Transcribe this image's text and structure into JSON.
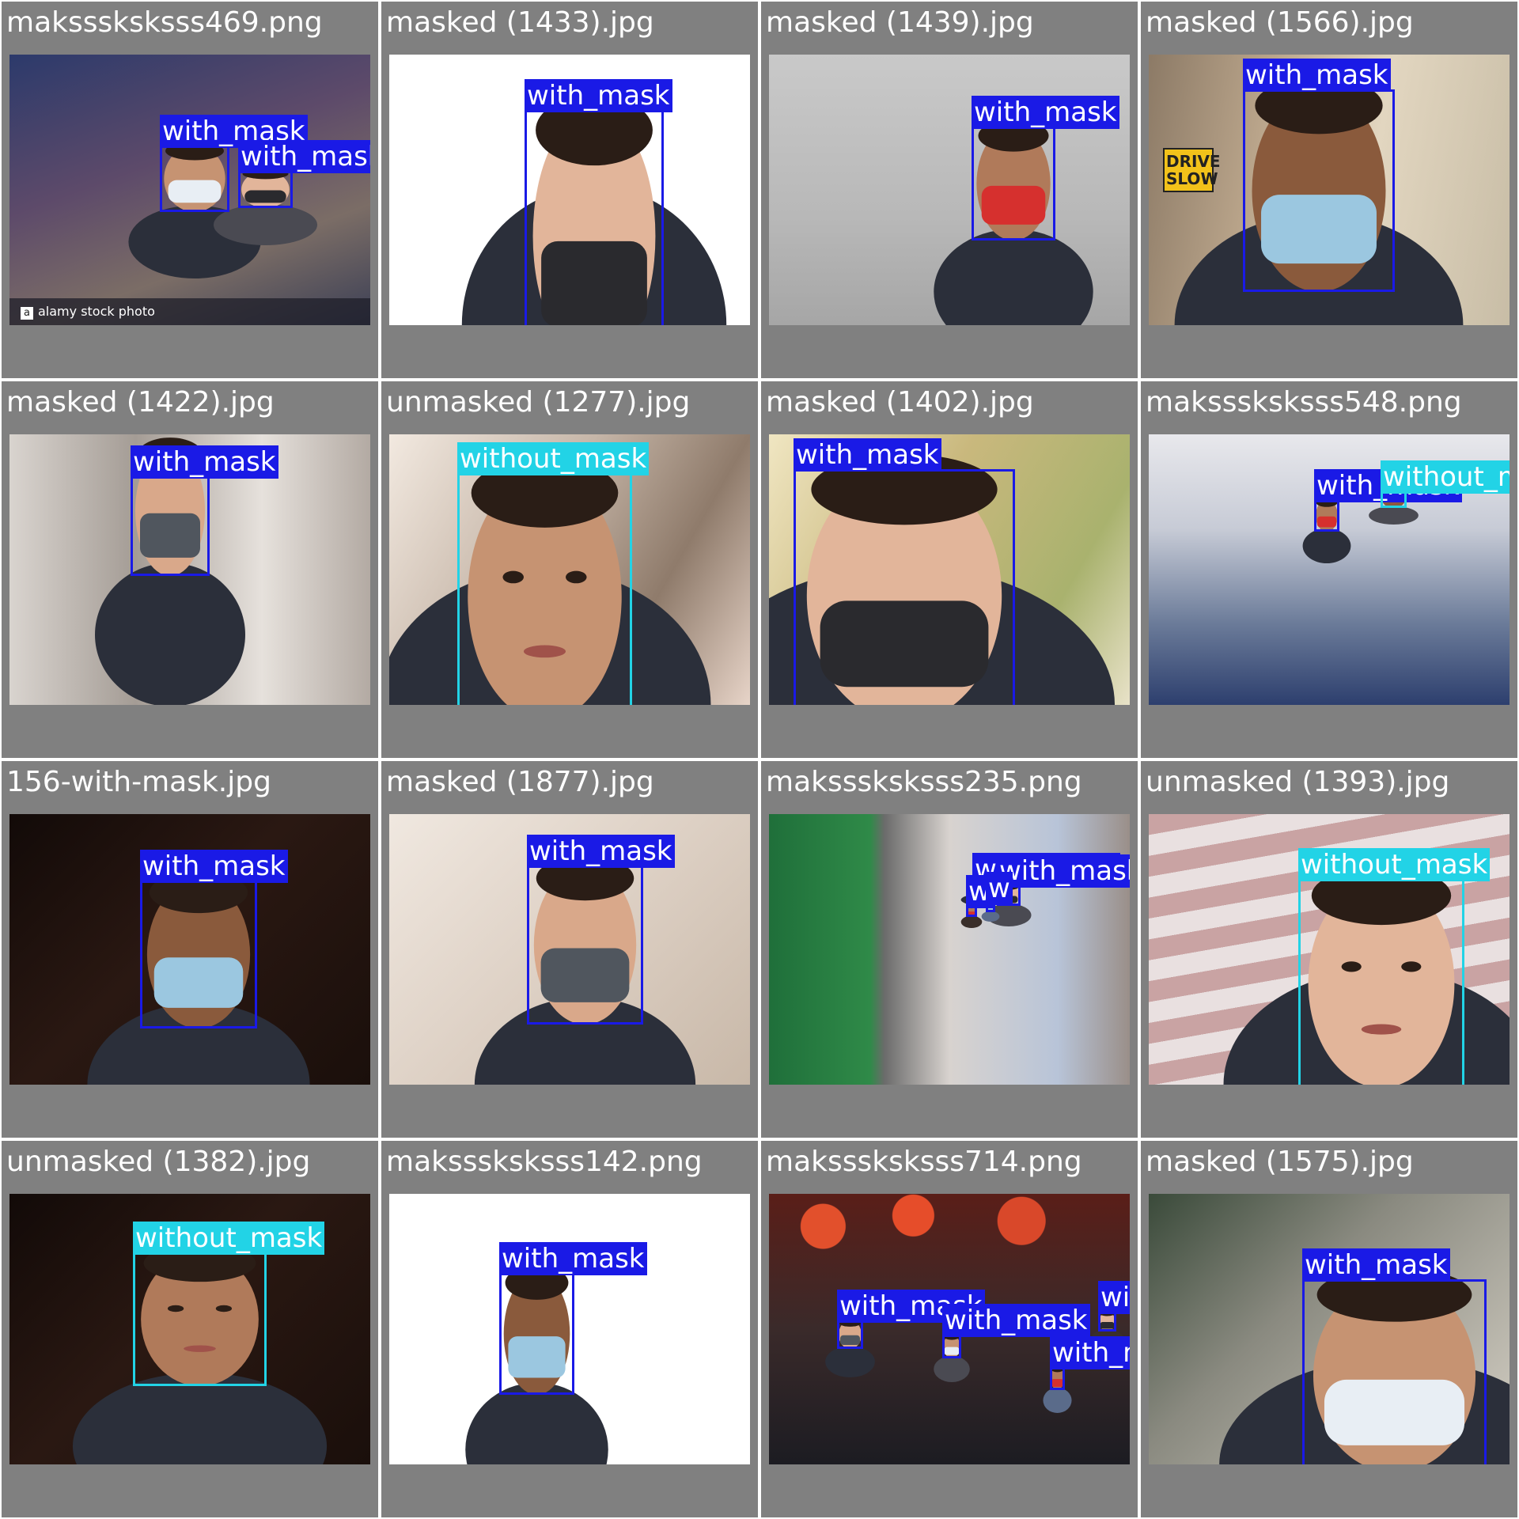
{
  "colors": {
    "panel_bg": "#808080",
    "with_mask": "#1a1ae6",
    "without_mask": "#22d3e6"
  },
  "icons": {
    "person": "person-photo-icon",
    "mask": "face-mask-icon"
  },
  "cells": [
    {
      "title": "maksssksksss469.png",
      "scene": "street",
      "watermark": "alamy stock photo",
      "detections": [
        {
          "label": "with_mask"
        },
        {
          "label": "with_mask"
        }
      ]
    },
    {
      "title": "masked (1433).jpg",
      "scene": "mannequin",
      "detections": [
        {
          "label": "with_mask"
        }
      ]
    },
    {
      "title": "masked (1439).jpg",
      "scene": "fog",
      "detections": [
        {
          "label": "with_mask"
        }
      ]
    },
    {
      "title": "masked (1566).jpg",
      "scene": "road",
      "sign": "DRIVE SLOW",
      "detections": [
        {
          "label": "with_mask"
        }
      ]
    },
    {
      "title": "masked (1422).jpg",
      "scene": "city",
      "detections": [
        {
          "label": "with_mask"
        }
      ]
    },
    {
      "title": "unmasked (1277).jpg",
      "scene": "portrait",
      "detections": [
        {
          "label": "without_mask"
        }
      ]
    },
    {
      "title": "masked (1402).jpg",
      "scene": "cyclist",
      "detections": [
        {
          "label": "with_mask"
        }
      ]
    },
    {
      "title": "maksssksksss548.png",
      "scene": "store",
      "detections": [
        {
          "label": "with_mask"
        },
        {
          "label": "without_mask"
        }
      ]
    },
    {
      "title": "156-with-mask.jpg",
      "scene": "dark",
      "detections": [
        {
          "label": "with_mask"
        }
      ]
    },
    {
      "title": "masked (1877).jpg",
      "scene": "light",
      "detections": [
        {
          "label": "with_mask"
        }
      ]
    },
    {
      "title": "maksssksksss235.png",
      "scene": "mall",
      "detections": [
        {
          "label": "with_mask"
        },
        {
          "label": "with_mask"
        },
        {
          "label": "w"
        },
        {
          "label": "w"
        }
      ]
    },
    {
      "title": "unmasked (1393).jpg",
      "scene": "flag",
      "detections": [
        {
          "label": "without_mask"
        }
      ]
    },
    {
      "title": "unmasked (1382).jpg",
      "scene": "dark",
      "detections": [
        {
          "label": "without_mask"
        }
      ]
    },
    {
      "title": "maksssksksss142.png",
      "scene": "white",
      "detections": [
        {
          "label": "with_mask"
        }
      ]
    },
    {
      "title": "maksssksksss714.png",
      "scene": "lanterns",
      "detections": [
        {
          "label": "with_mask"
        },
        {
          "label": "with_mask"
        },
        {
          "label": "with_mask"
        },
        {
          "label": "with_mask"
        }
      ]
    },
    {
      "title": "masked (1575).jpg",
      "scene": "closeup",
      "detections": [
        {
          "label": "with_mask"
        }
      ]
    }
  ]
}
